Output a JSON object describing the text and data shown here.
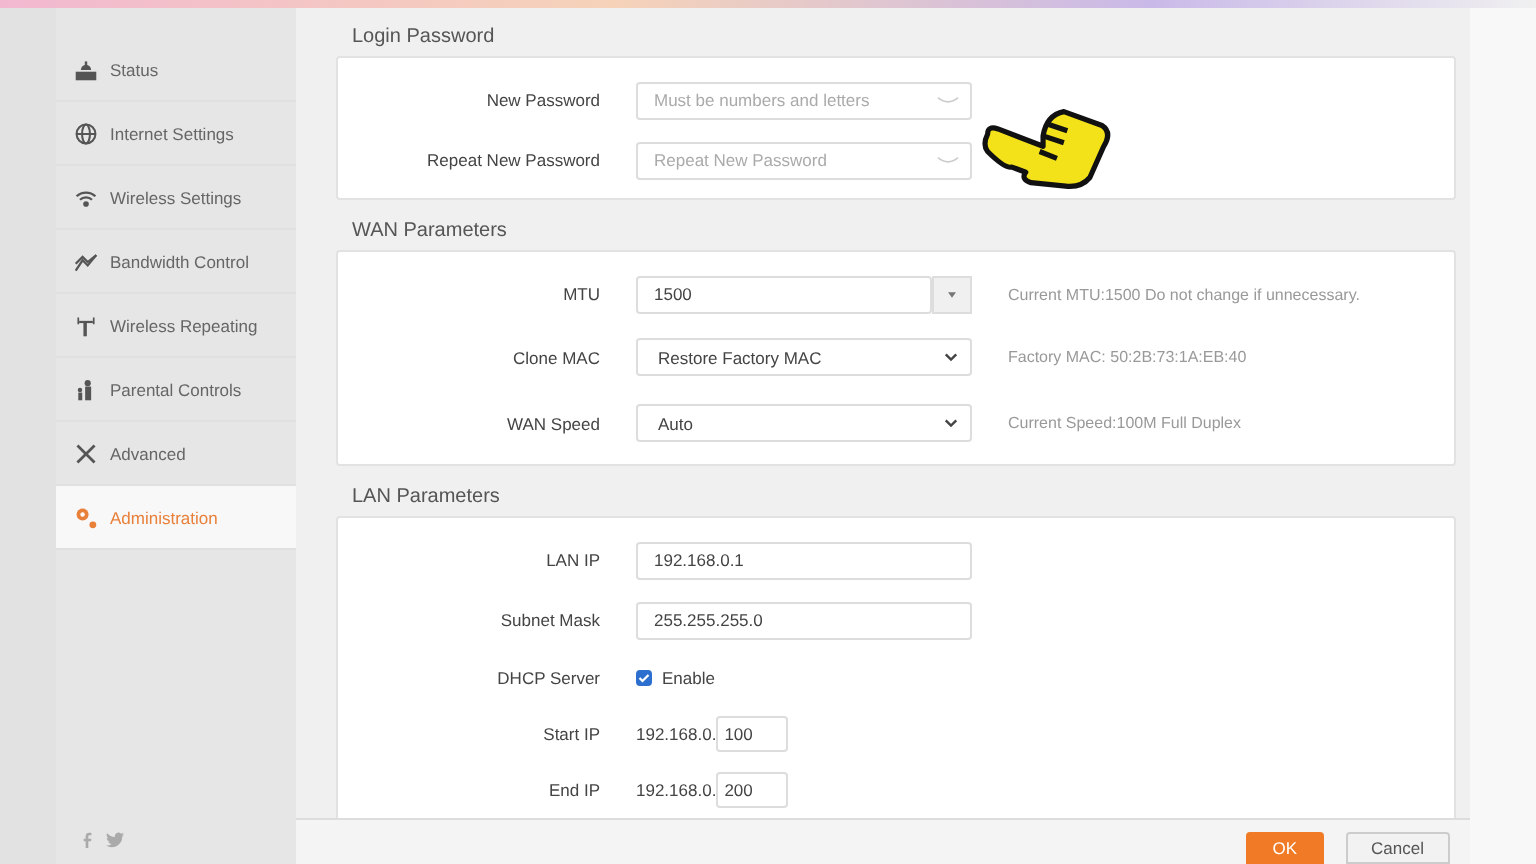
{
  "sidebar": {
    "items": [
      {
        "label": "Status",
        "selected": false
      },
      {
        "label": "Internet Settings",
        "selected": false
      },
      {
        "label": "Wireless Settings",
        "selected": false
      },
      {
        "label": "Bandwidth Control",
        "selected": false
      },
      {
        "label": "Wireless Repeating",
        "selected": false
      },
      {
        "label": "Parental Controls",
        "selected": false
      },
      {
        "label": "Advanced",
        "selected": false
      },
      {
        "label": "Administration",
        "selected": true
      }
    ]
  },
  "sections": [
    {
      "title": "Login Password",
      "rows": [
        {
          "kind": "password",
          "label": "New Password",
          "placeholder": "Must be numbers and letters"
        },
        {
          "kind": "password",
          "label": "Repeat New Password",
          "placeholder": "Repeat New Password"
        }
      ]
    },
    {
      "title": "WAN Parameters",
      "rows": [
        {
          "kind": "combo",
          "label": "MTU",
          "value": "1500",
          "note": "Current MTU:1500 Do not change if unnecessary."
        },
        {
          "kind": "select",
          "label": "Clone MAC",
          "value": "Restore Factory MAC",
          "note": "Factory MAC: 50:2B:73:1A:EB:40"
        },
        {
          "kind": "select",
          "label": "WAN Speed",
          "value": "Auto",
          "note": "Current Speed:100M Full Duplex"
        }
      ]
    },
    {
      "title": "LAN Parameters",
      "rows": [
        {
          "kind": "input",
          "label": "LAN IP",
          "value": "192.168.0.1"
        },
        {
          "kind": "input",
          "label": "Subnet Mask",
          "value": "255.255.255.0"
        },
        {
          "kind": "checkbox",
          "label": "DHCP Server",
          "option": "Enable",
          "checked": true
        },
        {
          "kind": "ip_suffix",
          "label": "Start IP",
          "prefix": "192.168.0.",
          "value": "100"
        },
        {
          "kind": "ip_suffix",
          "label": "End IP",
          "prefix": "192.168.0.",
          "value": "200"
        }
      ]
    }
  ],
  "footer": {
    "buttons": [
      {
        "label": "OK",
        "kind": "primary"
      },
      {
        "label": "Cancel",
        "kind": "secondary"
      }
    ]
  }
}
